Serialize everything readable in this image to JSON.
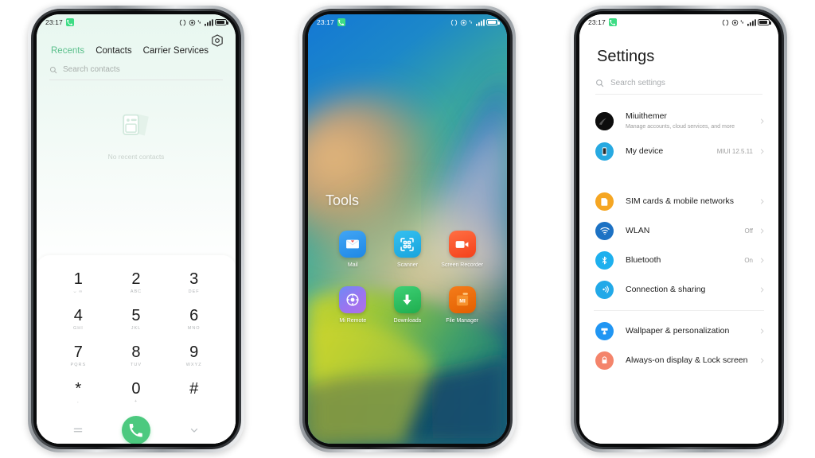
{
  "statusbar": {
    "time": "23:17",
    "call_badge_icon": "phone-icon",
    "icons": [
      "nfc-icon",
      "alarm-icon",
      "vpn-icon",
      "signal-icon",
      "battery-icon"
    ]
  },
  "phone1": {
    "name": "dialer-phone",
    "gear_icon": "settings-gear-icon",
    "tabs": [
      {
        "label": "Recents",
        "active": true
      },
      {
        "label": "Contacts",
        "active": false
      },
      {
        "label": "Carrier Services",
        "active": false
      }
    ],
    "search": {
      "placeholder": "Search contacts",
      "icon": "search-icon"
    },
    "empty_state": {
      "icon": "contacts-placeholder-icon",
      "text": "No recent contacts"
    },
    "keypad": [
      {
        "digit": "1",
        "letters": "⌣ ∞"
      },
      {
        "digit": "2",
        "letters": "ABC"
      },
      {
        "digit": "3",
        "letters": "DEF"
      },
      {
        "digit": "4",
        "letters": "GHI"
      },
      {
        "digit": "5",
        "letters": "JKL"
      },
      {
        "digit": "6",
        "letters": "MNO"
      },
      {
        "digit": "7",
        "letters": "PQRS"
      },
      {
        "digit": "8",
        "letters": "TUV"
      },
      {
        "digit": "9",
        "letters": "WXYZ"
      },
      {
        "digit": "*",
        "letters": ","
      },
      {
        "digit": "0",
        "letters": "+"
      },
      {
        "digit": "#",
        "letters": ""
      }
    ],
    "actions": {
      "menu_icon": "menu-lines-icon",
      "call_icon": "call-handset-icon",
      "collapse_icon": "chevron-down-icon",
      "call_button_color": "#4cc97f"
    }
  },
  "phone2": {
    "name": "home-screen-phone",
    "folder_title": "Tools",
    "apps": [
      {
        "label": "Mail",
        "icon": "mail-icon",
        "color": "#2196f3"
      },
      {
        "label": "Scanner",
        "icon": "qr-scanner-icon",
        "color": "#29b6e8"
      },
      {
        "label": "Screen Recorder",
        "icon": "video-camera-icon",
        "color": "#f4511e"
      },
      {
        "label": "Mi Remote",
        "icon": "remote-dpad-icon",
        "color": "#7c6df0"
      },
      {
        "label": "Downloads",
        "icon": "download-arrow-icon",
        "color": "#2bbf5a"
      },
      {
        "label": "File Manager",
        "icon": "file-folder-mi-icon",
        "color": "#ef6c00"
      }
    ]
  },
  "phone3": {
    "name": "settings-phone",
    "title": "Settings",
    "search": {
      "placeholder": "Search settings",
      "icon": "search-icon"
    },
    "groups": [
      {
        "rows": [
          {
            "title": "Miuithemer",
            "subtitle": "Manage accounts, cloud services, and more",
            "value": "",
            "icon": "account-avatar-icon",
            "color": "#111111"
          },
          {
            "title": "My device",
            "subtitle": "",
            "value": "MIUI 12.5.11",
            "icon": "device-phone-icon",
            "color": "#27a9e1"
          }
        ]
      },
      {
        "rows": [
          {
            "title": "SIM cards & mobile networks",
            "subtitle": "",
            "value": "",
            "icon": "sim-card-icon",
            "color": "#f5a623"
          },
          {
            "title": "WLAN",
            "subtitle": "",
            "value": "Off",
            "icon": "wifi-icon",
            "color": "#1d72c4"
          },
          {
            "title": "Bluetooth",
            "subtitle": "",
            "value": "On",
            "icon": "bluetooth-icon",
            "color": "#1eb0ee"
          },
          {
            "title": "Connection & sharing",
            "subtitle": "",
            "value": "",
            "icon": "connection-sharing-icon",
            "color": "#22a9e8"
          }
        ]
      },
      {
        "rows": [
          {
            "title": "Wallpaper & personalization",
            "subtitle": "",
            "value": "",
            "icon": "paint-roller-icon",
            "color": "#2196f3"
          },
          {
            "title": "Always-on display & Lock screen",
            "subtitle": "",
            "value": "",
            "icon": "lock-icon",
            "color": "#f4846b"
          }
        ]
      }
    ],
    "chevron_icon": "chevron-right-icon"
  }
}
